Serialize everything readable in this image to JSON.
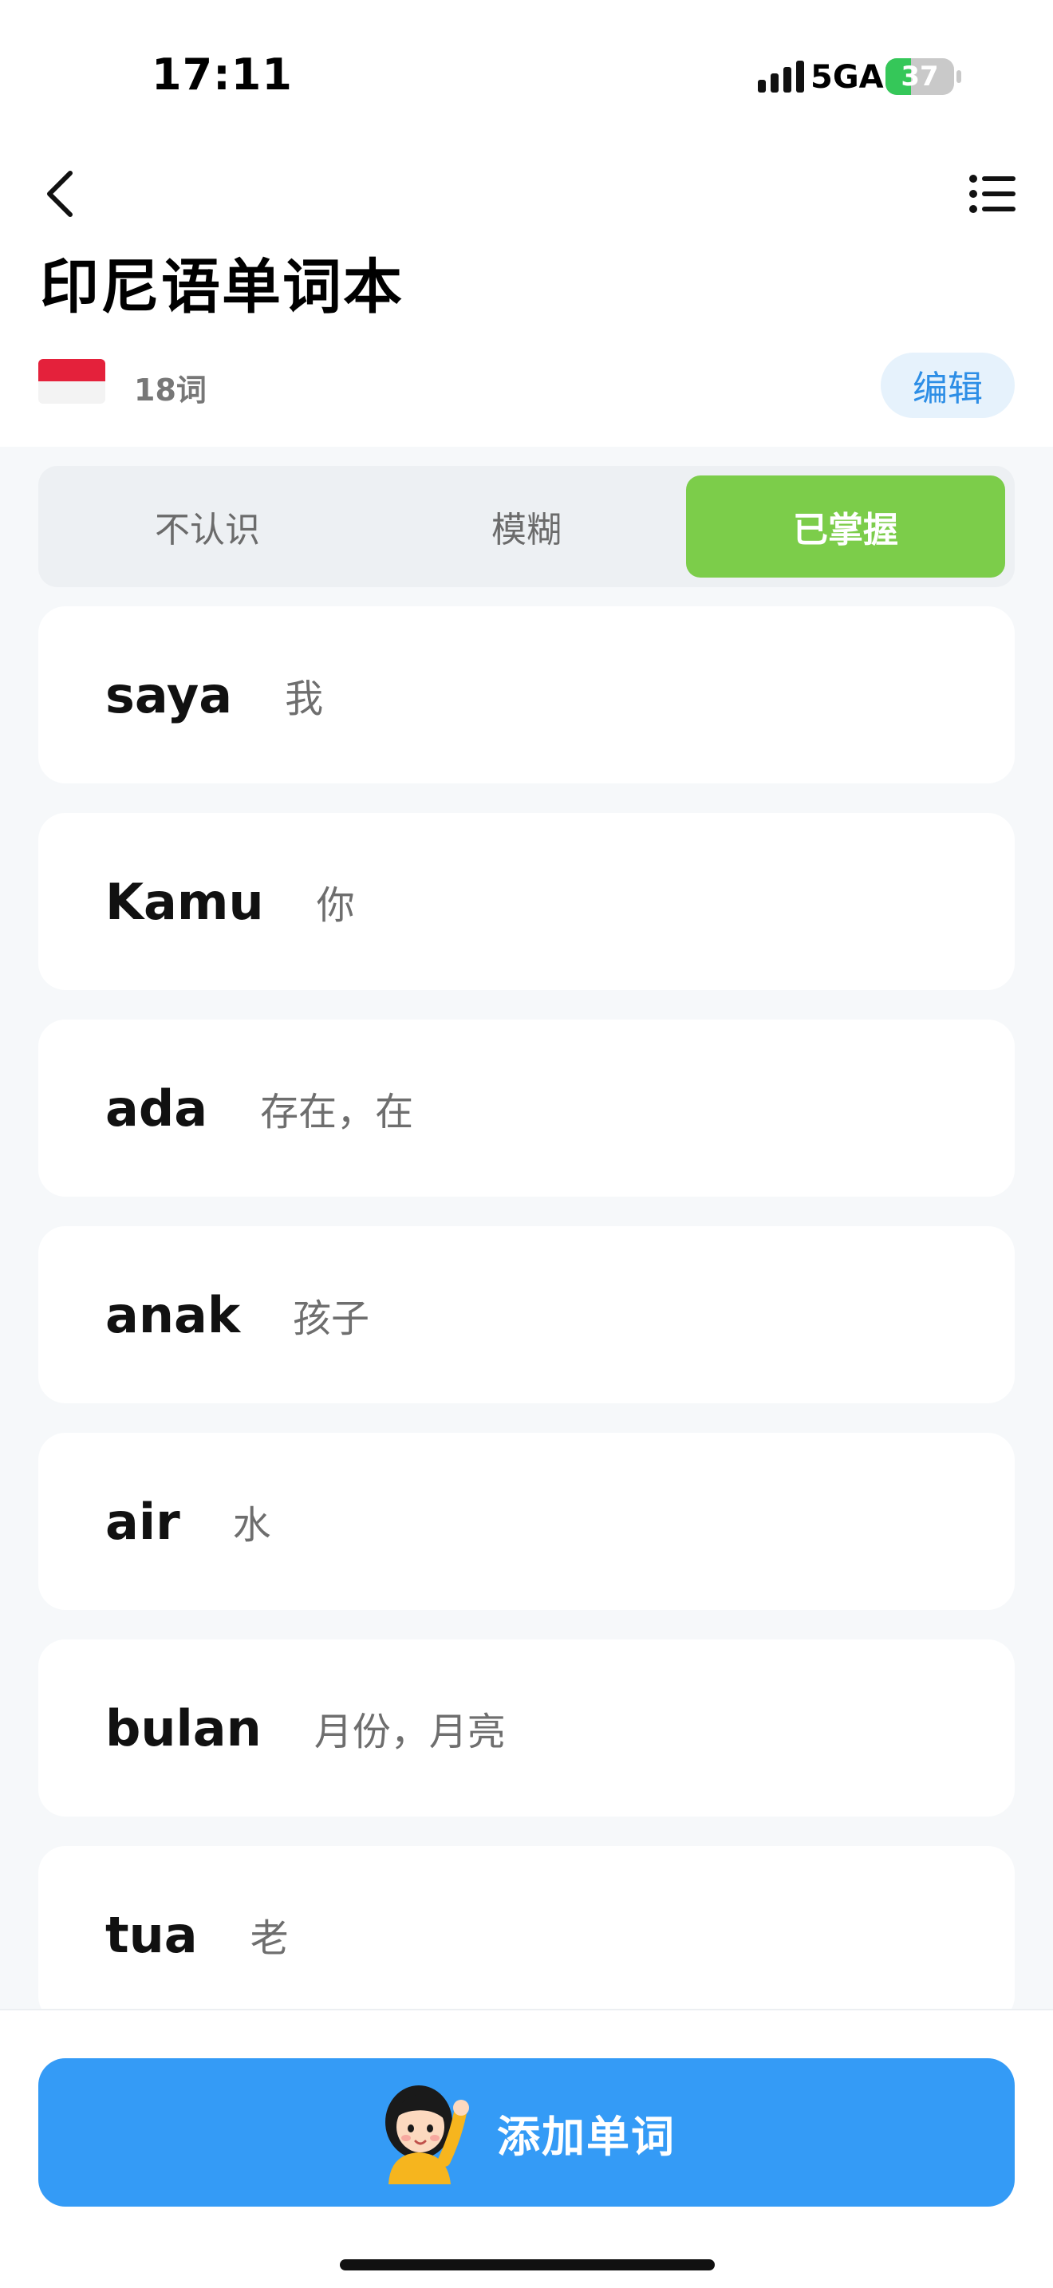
{
  "status_bar": {
    "time": "17:11",
    "network": "5GA",
    "battery": "37",
    "battery_level": 0.37
  },
  "header": {
    "title": "印尼语单词本",
    "word_count": "18词",
    "edit_label": "编辑"
  },
  "tabs": [
    {
      "label": "不认识",
      "active": false
    },
    {
      "label": "模糊",
      "active": false
    },
    {
      "label": "已掌握",
      "active": true
    }
  ],
  "words": [
    {
      "word": "saya",
      "meaning": "我"
    },
    {
      "word": "Kamu",
      "meaning": "你"
    },
    {
      "word": "ada",
      "meaning": "存在，在"
    },
    {
      "word": "anak",
      "meaning": "孩子"
    },
    {
      "word": "air",
      "meaning": "水"
    },
    {
      "word": "bulan",
      "meaning": "月份，月亮"
    },
    {
      "word": "tua",
      "meaning": "老"
    }
  ],
  "footer": {
    "add_label": "添加单词"
  },
  "colors": {
    "accent_green": "#7ccd4a",
    "accent_blue": "#349bf6",
    "edit_text": "#2d8ee6",
    "flag_red": "#e4213b"
  }
}
